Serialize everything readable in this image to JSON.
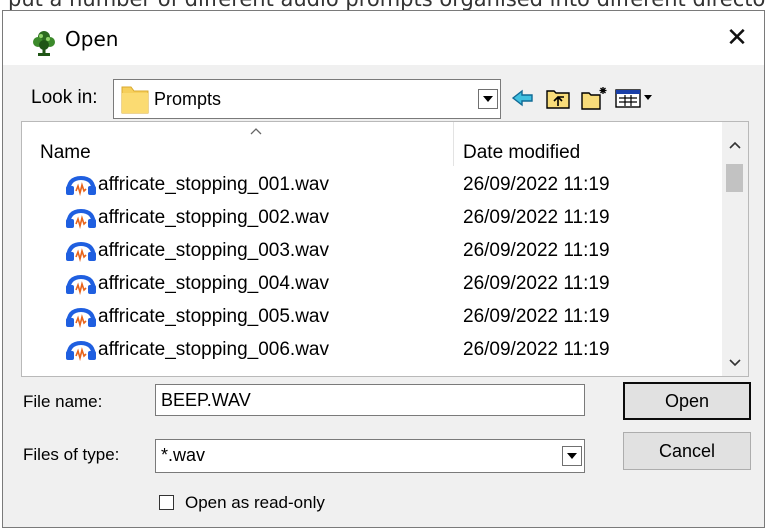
{
  "background_text": "put a number of different audio prompts organised into different directory",
  "window": {
    "title": "Open",
    "close_glyph": "✕"
  },
  "lookin": {
    "label": "Look in:",
    "value": "Prompts"
  },
  "toolbar": {
    "icons": [
      "back-icon",
      "up-folder-icon",
      "new-folder-icon",
      "view-menu-icon"
    ]
  },
  "list": {
    "columns": {
      "name": "Name",
      "date": "Date modified"
    },
    "files": [
      {
        "name": "affricate_stopping_001.wav",
        "date": "26/09/2022 11:19"
      },
      {
        "name": "affricate_stopping_002.wav",
        "date": "26/09/2022 11:19"
      },
      {
        "name": "affricate_stopping_003.wav",
        "date": "26/09/2022 11:19"
      },
      {
        "name": "affricate_stopping_004.wav",
        "date": "26/09/2022 11:19"
      },
      {
        "name": "affricate_stopping_005.wav",
        "date": "26/09/2022 11:19"
      },
      {
        "name": "affricate_stopping_006.wav",
        "date": "26/09/2022 11:19"
      }
    ]
  },
  "form": {
    "filename_label": "File name:",
    "filename_value": "BEEP.WAV",
    "filetype_label": "Files of type:",
    "filetype_value": "*.wav",
    "readonly_label": "Open as read-only",
    "readonly_checked": false
  },
  "buttons": {
    "open": "Open",
    "cancel": "Cancel"
  },
  "colors": {
    "folder": "#f6cf5b",
    "audio_icon": "#1f5fe0",
    "audio_accent": "#e8641b"
  }
}
